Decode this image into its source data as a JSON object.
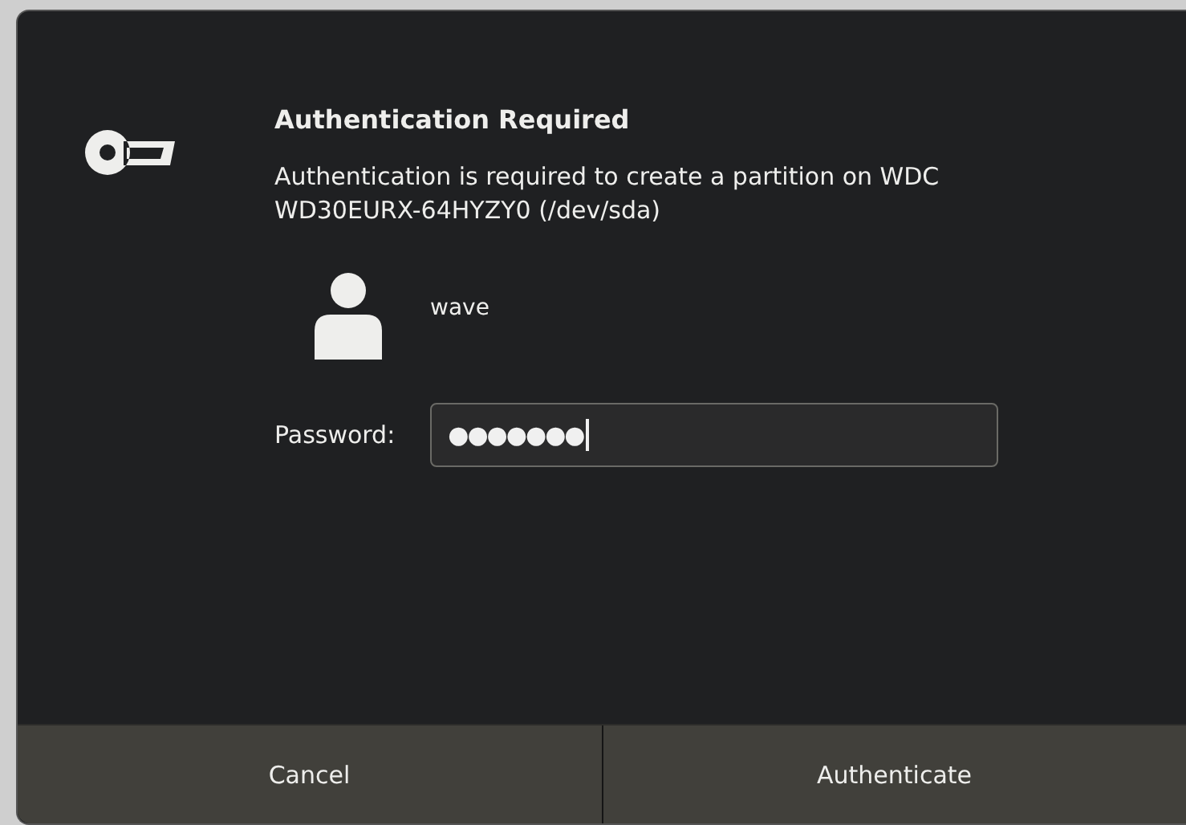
{
  "dialog": {
    "title": "Authentication Required",
    "message": "Authentication is required to create a partition on WDC WD30EURX-64HYZY0 (/dev/sda)",
    "user": "wave",
    "password": {
      "label": "Password:",
      "value": "●●●●●●●",
      "focused": true
    },
    "buttons": [
      {
        "label": "Cancel"
      },
      {
        "label": "Authenticate"
      }
    ]
  }
}
